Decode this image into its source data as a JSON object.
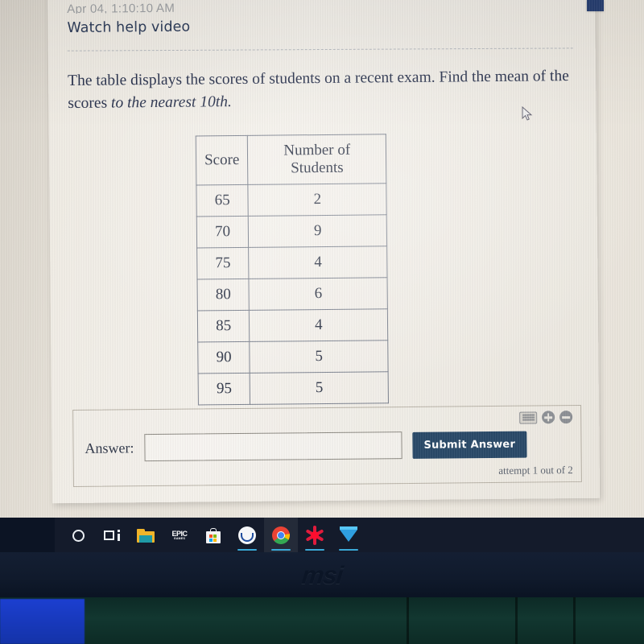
{
  "screen": {
    "timestamp": "Apr 04, 1:10:10 AM",
    "watch_help_label": "Watch help video",
    "question_part1": "The table displays the scores of students on a recent exam. Find the mean of the scores ",
    "question_part2": "to the nearest 10th."
  },
  "table": {
    "headers": [
      "Score",
      "Number of Students"
    ],
    "rows": [
      [
        "65",
        "2"
      ],
      [
        "70",
        "9"
      ],
      [
        "75",
        "4"
      ],
      [
        "80",
        "6"
      ],
      [
        "85",
        "4"
      ],
      [
        "90",
        "5"
      ],
      [
        "95",
        "5"
      ]
    ]
  },
  "answer": {
    "label": "Answer:",
    "input_value": "",
    "input_placeholder": "",
    "submit_label": "Submit Answer",
    "attempt_text": "attempt 1 out of 2",
    "tools": [
      {
        "icon": "keyboard-icon"
      },
      {
        "icon": "zoom-in-icon"
      },
      {
        "icon": "zoom-out-icon"
      }
    ]
  },
  "taskbar": {
    "items": [
      {
        "icon": "cortana-search-icon",
        "active": false
      },
      {
        "icon": "task-view-icon",
        "active": false
      },
      {
        "icon": "file-explorer-icon",
        "active": false
      },
      {
        "icon": "epic-games-icon",
        "active": false,
        "line1": "EPIC",
        "line2": "GAMES"
      },
      {
        "icon": "microsoft-store-icon",
        "active": false
      },
      {
        "icon": "blue-smile-app-icon",
        "active": false
      },
      {
        "icon": "google-chrome-icon",
        "active": true
      },
      {
        "icon": "red-star-app-icon",
        "active": false
      },
      {
        "icon": "blue-diamond-icon",
        "active": false
      }
    ]
  },
  "hardware": {
    "brand_logo": "msi"
  },
  "colors": {
    "submit_button": "#2a4a68",
    "taskbar": "#141b2b",
    "page_text": "#2c3550",
    "card_background": "#f2eee7",
    "desk": "#123730"
  }
}
